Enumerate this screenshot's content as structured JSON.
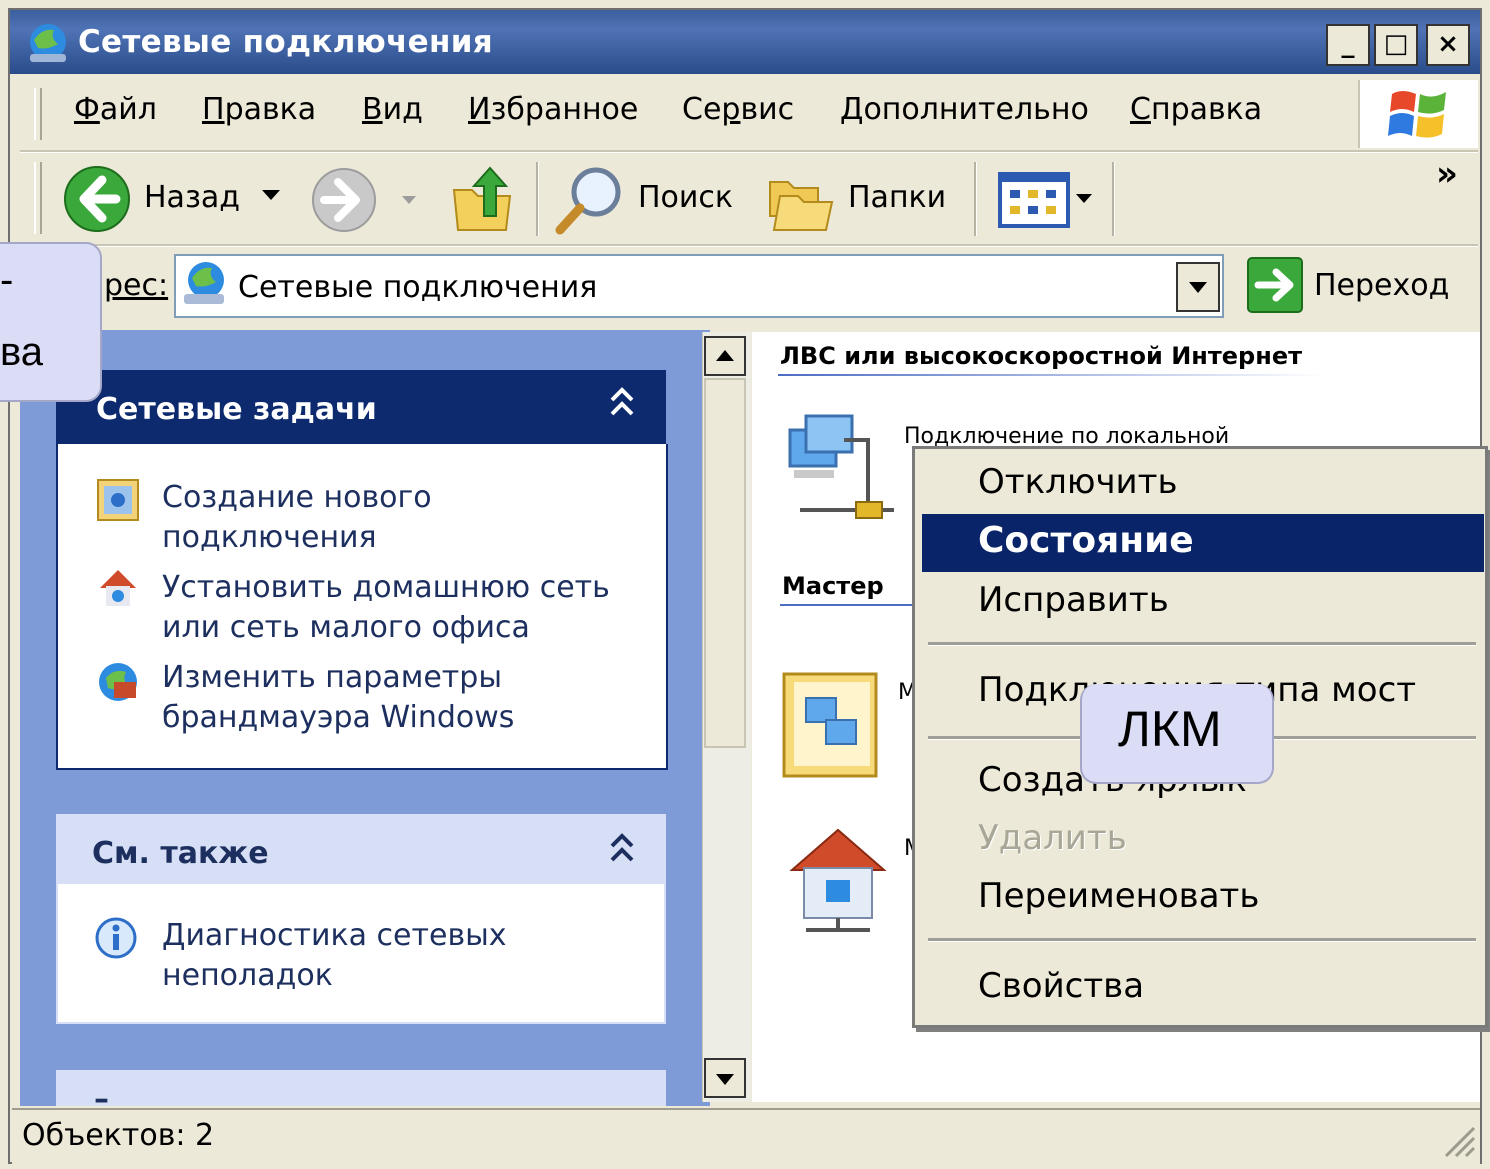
{
  "window": {
    "title": "Сетевые подключения",
    "minimize": "_",
    "maximize": "□",
    "close": "×"
  },
  "menu": {
    "file": {
      "u": "Ф",
      "rest": "айл"
    },
    "edit": {
      "u": "П",
      "rest": "равка"
    },
    "view": {
      "u": "В",
      "rest": "ид"
    },
    "favorites": {
      "u": "И",
      "rest": "збранное"
    },
    "tools": {
      "pre": "Се",
      "u": "р",
      "rest": "вис"
    },
    "advanced": {
      "u": "Д",
      "rest": "ополнительно"
    },
    "help": {
      "u": "С",
      "rest": "правка"
    }
  },
  "toolbar": {
    "back": "Назад",
    "search": "Поиск",
    "folders": "Папки",
    "overflow": "»"
  },
  "address": {
    "label": "рес:",
    "value": "Сетевые подключения",
    "go": "Переход"
  },
  "left_callout": {
    "line1": "-",
    "line2": "ва"
  },
  "network_tasks": {
    "title": "Сетевые задачи",
    "items": [
      {
        "l1": "Создание нового",
        "l2": "подключения"
      },
      {
        "l1": "Установить домашнюю сеть",
        "l2": "или сеть малого офиса"
      },
      {
        "l1": "Изменить параметры",
        "l2": "брандмауэра Windows"
      }
    ]
  },
  "see_also": {
    "title": "См. также",
    "items": [
      {
        "l1": "Диагностика сетевых",
        "l2": "неполадок"
      }
    ]
  },
  "third_panel": {
    "title": "–"
  },
  "content": {
    "group1": "ЛВС или высокоскоростной Интернет",
    "connection_name": "Подключение по локальной",
    "group2": "Мастер",
    "item_m1": "М",
    "item_m2": "М"
  },
  "context_menu": {
    "items": [
      "Отключить",
      "Состояние",
      "Исправить",
      "Подключения типа мост",
      "Создать ярлык",
      "Удалить",
      "Переименовать",
      "Свойства"
    ],
    "selected_index": 1,
    "disabled_index": 5
  },
  "lkm_callout": "ЛКМ",
  "status": "Объектов: 2",
  "colors": {
    "selection": "#0a246a",
    "panel_header": "#0d2a6e",
    "callout": "#dbdcf6",
    "window_face": "#ece9d8"
  }
}
